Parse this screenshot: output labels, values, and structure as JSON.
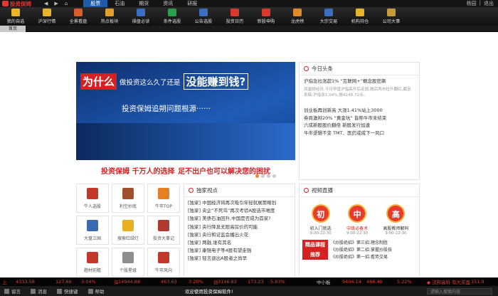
{
  "app": {
    "title": "投资保姆",
    "user": "杨园",
    "logout": "退出"
  },
  "titlebar": {
    "nav": [
      "◀",
      "▶",
      "⌂"
    ],
    "menu": [
      "股票",
      "石油",
      "期货",
      "资讯",
      "研报"
    ],
    "active": 0
  },
  "toolbar": [
    {
      "label": "我的自选",
      "icon": "star-icon",
      "color": "#e8b42c"
    },
    {
      "label": "沪深行情",
      "icon": "market-icon",
      "color": "#e8b42c"
    },
    {
      "label": "全景看盘",
      "icon": "panorama-icon",
      "color": "#d95c2b"
    },
    {
      "label": "热点板块",
      "icon": "hot-icon",
      "color": "#e0a030"
    },
    {
      "label": "操盘必读",
      "icon": "book-icon",
      "color": "#3b6fc4"
    },
    {
      "label": "条件选股",
      "icon": "filter-icon",
      "color": "#2aa04a"
    },
    {
      "label": "公告选股",
      "icon": "notice-icon",
      "color": "#3b6fc4"
    },
    {
      "label": "投资日历",
      "icon": "calendar-icon",
      "color": "#d83a2f"
    },
    {
      "label": "新股申购",
      "icon": "ipo-icon",
      "color": "#d83a2f"
    },
    {
      "label": "龙虎榜",
      "icon": "dragon-icon",
      "color": "#e08a2a"
    },
    {
      "label": "大宗交易",
      "icon": "trade-icon",
      "color": "#3b6fc4"
    },
    {
      "label": "机构持仓",
      "icon": "holding-icon",
      "color": "#e8b42c"
    },
    {
      "label": "公司大事",
      "icon": "event-icon",
      "color": "#c89a3a"
    }
  ],
  "tab": "首页",
  "banner": {
    "big": "为什么",
    "mid": "做投资这么久了还是",
    "q": "没能赚到钱?",
    "sub": "投资保姆追朔问题根源······",
    "bottom1": "投资保姆 千万人的选择",
    "bottom2": "足不出户也可以解决您的困扰"
  },
  "news": {
    "title": "今日头条",
    "lead": "沪指急拉涨超1% “互联网+”概念股狂飙",
    "lead_desc": "凤凰财经讯 今日早盘沪指高开后走弱,随后两市拉升翻红,截至发稿:沪指涨1.04%,报4248.72点。",
    "items": [
      "创业板再创新高 大涨1.41%站上3000",
      "券商激辩20% “黄金坑” 皆称牛市未结束",
      "六成新股股价翻倍 新股发行加速",
      "牛市逻辑不变 TMT、医药或成下一风口"
    ]
  },
  "grid": [
    {
      "label": "牛人选股",
      "icon": "bull-icon",
      "color": "#c0392b"
    },
    {
      "label": "利空抄底",
      "icon": "bottle-icon",
      "color": "#a0522d"
    },
    {
      "label": "牛市TOP",
      "icon": "top-icon",
      "color": "#e67e22"
    },
    {
      "label": "大盘三国",
      "icon": "chart-icon",
      "color": "#3a6ab0"
    },
    {
      "label": "搜索红绿灯",
      "icon": "traffic-light-icon",
      "color": "#e7b021"
    },
    {
      "label": "投资大事记",
      "icon": "hat-icon",
      "color": "#b03a2e"
    },
    {
      "label": "题材前瞻",
      "icon": "person-icon",
      "color": "#c0392b"
    },
    {
      "label": "个股星级",
      "icon": "pen-icon",
      "color": "#8e8e8e"
    },
    {
      "label": "牛市风向",
      "icon": "wind-icon",
      "color": "#c0392b"
    }
  ],
  "opinion": {
    "title": "独家视点",
    "items": [
      "[独家] 中国经济将再次吸引年轻就展策略划",
      "[独家] 央企“不死鸟”再次考验A股选市难度",
      "[独家] 美债石油回升,中国是否成为首家?",
      "[独家] 央行降息无限高房价的可能",
      "[独家] 央行和证监会播出火花",
      "[独家] 两融,谁有其名",
      "[独家] 康强电子等4股有望走强",
      "[独家] 轻言退出A股者之尚早"
    ]
  },
  "live": {
    "title": "视频直播",
    "hosts": [
      {
        "char": "初",
        "name": "初入门就选",
        "time": "9:00-22:30"
      },
      {
        "char": "中",
        "name": "中级必备术",
        "time": "9:00-22:30"
      },
      {
        "char": "高",
        "name": "高股教师解码",
        "time": "9:00-22:30"
      }
    ],
    "badge1": "精品课程",
    "badge2": "推荐",
    "items": [
      "《炒股绝招》第三招:理念制胜",
      "《炒股绝招》第二招:掌握炒股技",
      "《炒股绝招》第一招:看势交易"
    ]
  },
  "quotes": [
    {
      "text": "上",
      "color": "#e23a2e"
    },
    {
      "text": "4333.58",
      "color": "#e23a2e"
    },
    {
      "text": "127.66",
      "color": "#e23a2e"
    },
    {
      "text": "3.04%",
      "color": "#e23a2e"
    },
    {
      "text": "深",
      "color": "#e23a2e"
    },
    {
      "text": "14944.88",
      "color": "#e23a2e"
    },
    {
      "text": "463.63",
      "color": "#e23a2e"
    },
    {
      "text": "3.20%",
      "color": "#e23a2e"
    },
    {
      "text": "创",
      "color": "#e23a2e"
    },
    {
      "text": "3146.83",
      "color": "#e23a2e"
    },
    {
      "text": "173.23",
      "color": "#e23a2e"
    },
    {
      "text": "5.83%",
      "color": "#e23a2e"
    },
    {
      "text": "中小板",
      "color": "#cccccc"
    },
    {
      "text": "9404.14",
      "color": "#e23a2e"
    },
    {
      "text": "466.40",
      "color": "#e23a2e"
    },
    {
      "text": "5.22%",
      "color": "#e23a2e"
    },
    {
      "text": "◆ 汉邦高科 有大买盘",
      "color": "#e23a2e"
    },
    {
      "text": "151.9",
      "color": "#e23a2e"
    }
  ],
  "status": {
    "buttons": [
      "留言",
      "消息",
      "快捷键",
      "帮助"
    ],
    "message": "欢迎使用投资保姆软件!",
    "search": "请输入搜索内容"
  }
}
